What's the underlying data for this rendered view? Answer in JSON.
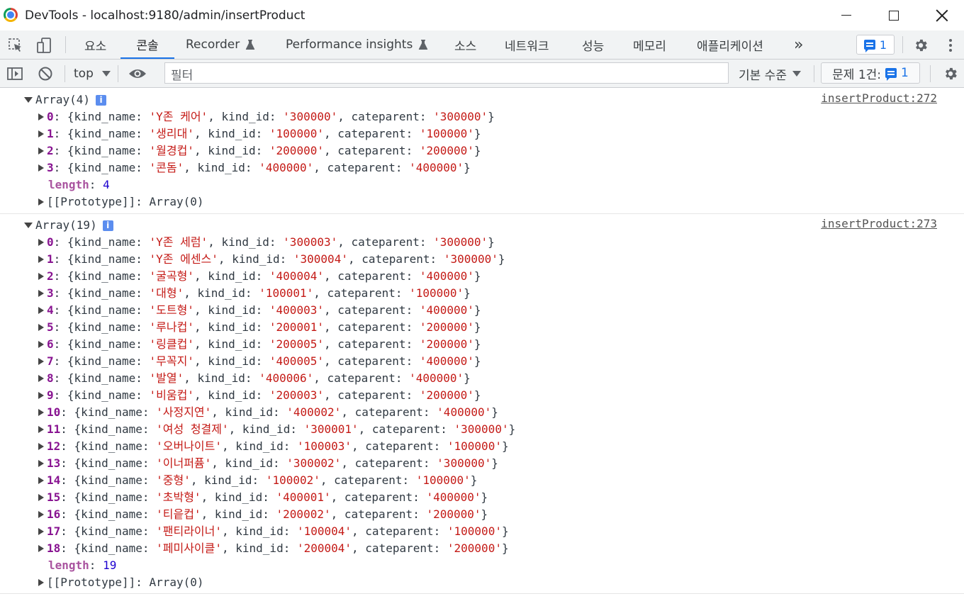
{
  "window": {
    "title": "DevTools - localhost:9180/admin/insertProduct"
  },
  "tabs": {
    "elements": "요소",
    "console": "콘솔",
    "recorder": "Recorder",
    "perf_insights": "Performance insights",
    "sources": "소스",
    "network": "네트워크",
    "performance": "성능",
    "memory": "메모리",
    "application": "애플리케이션",
    "more": "»",
    "issues_badge_count": "1"
  },
  "toolbar": {
    "context": "top",
    "filter_placeholder": "필터",
    "levels": "기본 수준",
    "issues_label": "문제 1건:",
    "issues_count": "1"
  },
  "console": {
    "group1": {
      "header": "Array(4)",
      "source": "insertProduct:272",
      "rows": [
        {
          "idx": "0",
          "name": "'Y존 케어'",
          "id": "'300000'",
          "parent": "'300000'"
        },
        {
          "idx": "1",
          "name": "'생리대'",
          "id": "'100000'",
          "parent": "'100000'"
        },
        {
          "idx": "2",
          "name": "'월경컵'",
          "id": "'200000'",
          "parent": "'200000'"
        },
        {
          "idx": "3",
          "name": "'콘돔'",
          "id": "'400000'",
          "parent": "'400000'"
        }
      ],
      "length_label": "length",
      "length": "4",
      "prototype": "[[Prototype]]: Array(0)"
    },
    "group2": {
      "header": "Array(19)",
      "source": "insertProduct:273",
      "rows": [
        {
          "idx": "0",
          "name": "'Y존 세럼'",
          "id": "'300003'",
          "parent": "'300000'"
        },
        {
          "idx": "1",
          "name": "'Y존 에센스'",
          "id": "'300004'",
          "parent": "'300000'"
        },
        {
          "idx": "2",
          "name": "'굴곡형'",
          "id": "'400004'",
          "parent": "'400000'"
        },
        {
          "idx": "3",
          "name": "'대형'",
          "id": "'100001'",
          "parent": "'100000'"
        },
        {
          "idx": "4",
          "name": "'도트형'",
          "id": "'400003'",
          "parent": "'400000'"
        },
        {
          "idx": "5",
          "name": "'루나컵'",
          "id": "'200001'",
          "parent": "'200000'"
        },
        {
          "idx": "6",
          "name": "'링클컵'",
          "id": "'200005'",
          "parent": "'200000'"
        },
        {
          "idx": "7",
          "name": "'무꼭지'",
          "id": "'400005'",
          "parent": "'400000'"
        },
        {
          "idx": "8",
          "name": "'발열'",
          "id": "'400006'",
          "parent": "'400000'"
        },
        {
          "idx": "9",
          "name": "'비움컵'",
          "id": "'200003'",
          "parent": "'200000'"
        },
        {
          "idx": "10",
          "name": "'사정지연'",
          "id": "'400002'",
          "parent": "'400000'"
        },
        {
          "idx": "11",
          "name": "'여성 청결제'",
          "id": "'300001'",
          "parent": "'300000'"
        },
        {
          "idx": "12",
          "name": "'오버나이트'",
          "id": "'100003'",
          "parent": "'100000'"
        },
        {
          "idx": "13",
          "name": "'이너퍼퓸'",
          "id": "'300002'",
          "parent": "'300000'"
        },
        {
          "idx": "14",
          "name": "'중형'",
          "id": "'100002'",
          "parent": "'100000'"
        },
        {
          "idx": "15",
          "name": "'초박형'",
          "id": "'400001'",
          "parent": "'400000'"
        },
        {
          "idx": "16",
          "name": "'티읕컵'",
          "id": "'200002'",
          "parent": "'200000'"
        },
        {
          "idx": "17",
          "name": "'팬티라이너'",
          "id": "'100004'",
          "parent": "'100000'"
        },
        {
          "idx": "18",
          "name": "'페미사이클'",
          "id": "'200004'",
          "parent": "'200000'"
        }
      ],
      "length_label": "length",
      "length": "19",
      "prototype": "[[Prototype]]: Array(0)"
    }
  }
}
